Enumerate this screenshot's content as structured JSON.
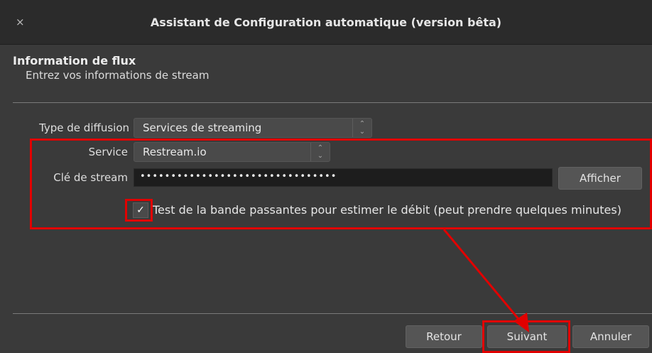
{
  "window": {
    "title": "Assistant de Configuration automatique (version bêta)",
    "close_glyph": "×"
  },
  "section": {
    "title": "Information de flux",
    "subtitle": "Entrez vos informations de stream"
  },
  "form": {
    "broadcast_type": {
      "label": "Type de diffusion",
      "value": "Services de streaming"
    },
    "service": {
      "label": "Service",
      "value": "Restream.io"
    },
    "stream_key": {
      "label": "Clé de stream",
      "value": "••••••••••••••••••••••••••••••••",
      "show_button": "Afficher"
    },
    "bandwidth_test": {
      "label": "Test de la bande passantes pour estimer le débit (peut prendre quelques minutes)",
      "checked": true,
      "check_glyph": "✓"
    }
  },
  "footer": {
    "back": "Retour",
    "next": "Suivant",
    "cancel": "Annuler"
  },
  "icons": {
    "combo_arrow": "⌃⌄"
  },
  "colors": {
    "annotation_red": "#e10000"
  }
}
